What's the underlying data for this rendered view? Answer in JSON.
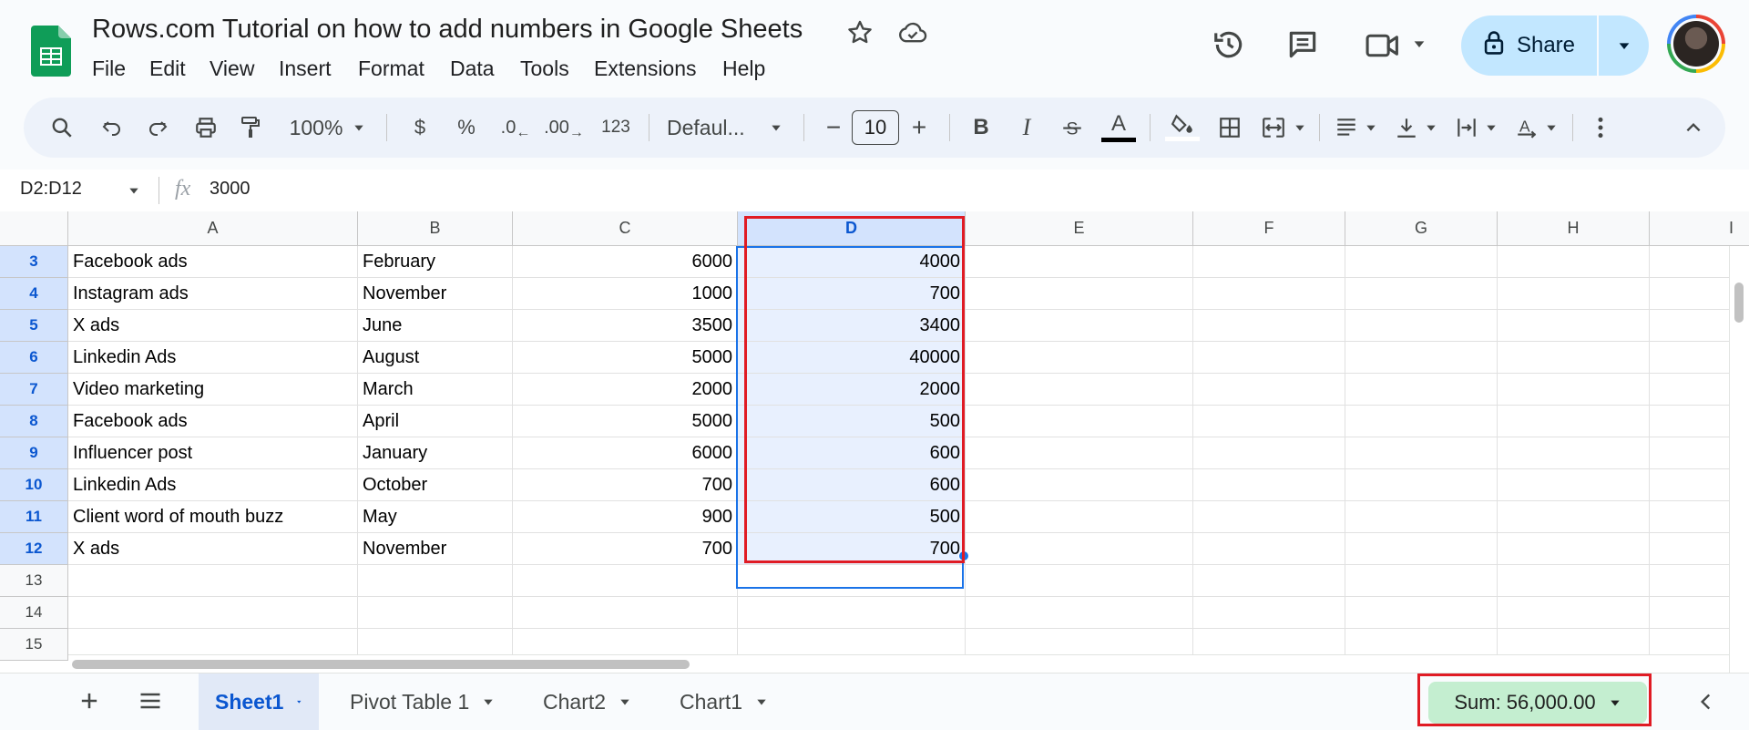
{
  "app": {
    "title": "Rows.com Tutorial on how to add numbers in Google Sheets",
    "menu": [
      "File",
      "Edit",
      "View",
      "Insert",
      "Format",
      "Data",
      "Tools",
      "Extensions",
      "Help"
    ],
    "share_label": "Share"
  },
  "toolbar": {
    "zoom": "100%",
    "currency": "$",
    "percent": "%",
    "dec_decrease": ".0",
    "dec_increase": ".00",
    "number_format": "123",
    "font": "Defaul...",
    "font_size": "10",
    "minus": "−",
    "plus": "+",
    "bold": "B",
    "italic": "I",
    "text_color_letter": "A"
  },
  "formula_bar": {
    "name_box": "D2:D12",
    "fx": "fx",
    "value": "3000"
  },
  "grid": {
    "columns": [
      "A",
      "B",
      "C",
      "D",
      "E",
      "F",
      "G",
      "H",
      "I"
    ],
    "rows": [
      {
        "num": "3",
        "a": "Facebook ads",
        "b": "February",
        "c": "6000",
        "d": "4000"
      },
      {
        "num": "4",
        "a": "Instagram ads",
        "b": "November",
        "c": "1000",
        "d": "700"
      },
      {
        "num": "5",
        "a": "X ads",
        "b": "June",
        "c": "3500",
        "d": "3400"
      },
      {
        "num": "6",
        "a": "Linkedin Ads",
        "b": "August",
        "c": "5000",
        "d": "40000"
      },
      {
        "num": "7",
        "a": "Video marketing",
        "b": "March",
        "c": "2000",
        "d": "2000"
      },
      {
        "num": "8",
        "a": "Facebook ads",
        "b": "April",
        "c": "5000",
        "d": "500"
      },
      {
        "num": "9",
        "a": "Influencer post",
        "b": "January",
        "c": "6000",
        "d": "600"
      },
      {
        "num": "10",
        "a": "Linkedin Ads",
        "b": "October",
        "c": "700",
        "d": "600"
      },
      {
        "num": "11",
        "a": "Client word of mouth buzz",
        "b": "May",
        "c": "900",
        "d": "500"
      },
      {
        "num": "12",
        "a": "X ads",
        "b": "November",
        "c": "700",
        "d": "700"
      },
      {
        "num": "13",
        "a": "",
        "b": "",
        "c": "",
        "d": ""
      },
      {
        "num": "14",
        "a": "",
        "b": "",
        "c": "",
        "d": ""
      },
      {
        "num": "15",
        "a": "",
        "b": "",
        "c": "",
        "d": ""
      }
    ]
  },
  "sheets": {
    "tabs": [
      "Sheet1",
      "Pivot Table 1",
      "Chart2",
      "Chart1"
    ],
    "active": "Sheet1",
    "sum_label": "Sum: 56,000.00"
  },
  "colors": {
    "accent": "#0b57d0",
    "share_bg": "#c2e7ff",
    "selection_bg": "#e8f0fe",
    "highlight_red": "#e01b24",
    "sum_bg": "#c4eed0"
  }
}
